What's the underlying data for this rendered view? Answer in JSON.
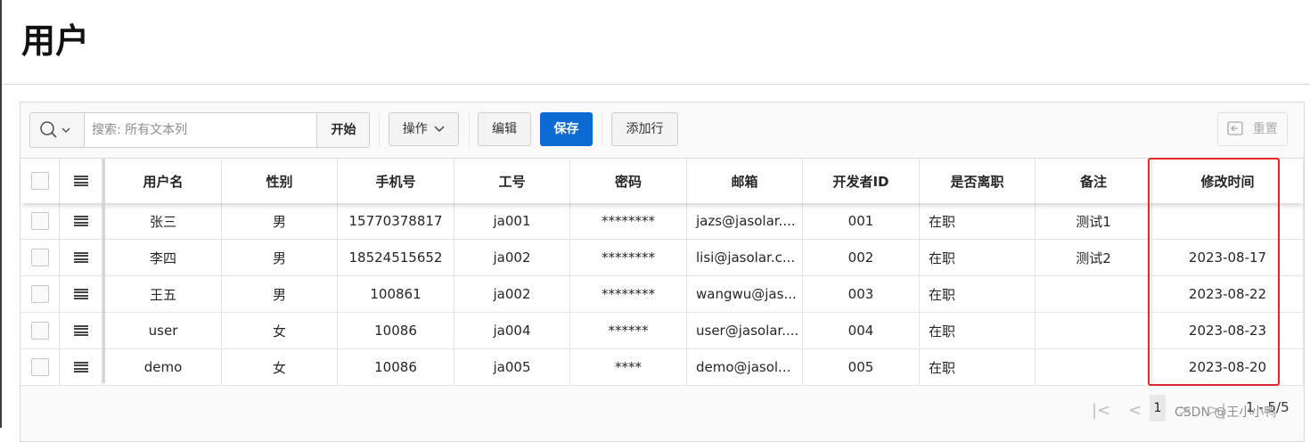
{
  "page_title": "用户",
  "search": {
    "placeholder": "搜索: 所有文本列",
    "value": "",
    "go_label": "开始"
  },
  "toolbar": {
    "actions_label": "操作",
    "edit_label": "编辑",
    "save_label": "保存",
    "add_row_label": "添加行",
    "reset_label": "重置"
  },
  "table": {
    "columns": [
      "用户名",
      "性别",
      "手机号",
      "工号",
      "密码",
      "邮箱",
      "开发者ID",
      "是否离职",
      "备注",
      "修改时间"
    ],
    "rows": [
      [
        "张三",
        "男",
        "15770378817",
        "ja001",
        "********",
        "jazs@jasolar....",
        "001",
        "在职",
        "测试1",
        ""
      ],
      [
        "李四",
        "男",
        "18524515652",
        "ja002",
        "********",
        "lisi@jasolar.c...",
        "002",
        "在职",
        "测试2",
        "2023-08-17"
      ],
      [
        "王五",
        "男",
        "100861",
        "ja002",
        "********",
        "wangwu@jas...",
        "003",
        "在职",
        "",
        "2023-08-22"
      ],
      [
        "user",
        "女",
        "10086",
        "ja004",
        "******",
        "user@jasolar....",
        "004",
        "在职",
        "",
        "2023-08-23"
      ],
      [
        "demo",
        "女",
        "10086",
        "ja005",
        "****",
        "demo@jasol...",
        "005",
        "在职",
        "",
        "2023-08-20"
      ]
    ]
  },
  "pagination": {
    "current_page": "1",
    "range_text": "1 - 5/5"
  },
  "watermark": "CSDN @王小小鸭",
  "colors": {
    "primary": "#0c6bd3",
    "highlight": "#e3262a"
  }
}
